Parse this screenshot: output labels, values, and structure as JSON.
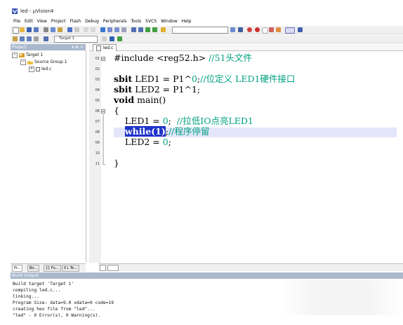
{
  "window": {
    "title": "led - μVision4"
  },
  "menu": [
    "File",
    "Edit",
    "View",
    "Project",
    "Flash",
    "Debug",
    "Peripherals",
    "Tools",
    "SVCS",
    "Window",
    "Help"
  ],
  "toolbar2": {
    "target_select": "Target 1"
  },
  "project_panel": {
    "title": "Project",
    "controls": "▾ ⊕ ×",
    "tree": [
      {
        "label": "Target 1",
        "toggle": "−"
      },
      {
        "label": "Source Group 1",
        "toggle": "−"
      },
      {
        "label": "led.c",
        "toggle": "+"
      }
    ],
    "bottom_tabs": [
      "Pr...",
      "Bo...",
      "{} Fu...",
      "0↓ Te..."
    ]
  },
  "editor": {
    "tab_label": "led.c",
    "line_numbers": [
      "01",
      "02",
      "03",
      "04",
      "05",
      "06",
      "07",
      "08",
      "09",
      "10",
      "11"
    ],
    "lines": {
      "l1_pre": "#include <reg52.h> ",
      "l1_comment": "//51头文件",
      "l3_kw": "sbit",
      "l3_rest": " LED1 = P1^",
      "l3_num": "0",
      "l3_semi": ";",
      "l3_comment": "//位定义 LED1硬件接口",
      "l4_kw": "sbit",
      "l4_rest": " LED2 = P1^1;",
      "l5_kw": "void",
      "l5_rest": " main()",
      "l6": "{",
      "l7_pre": "    LED1 = ",
      "l7_num": "0",
      "l7_semi": ";  ",
      "l7_comment": "//拉低IO点亮LED1",
      "l8_indent": "    ",
      "l8_sel": "while(1)",
      "l8_semi": ";",
      "l8_comment": "//程序停留",
      "l9_pre": "    LED2 = ",
      "l9_num": "0",
      "l9_semi": ";",
      "l11": "}"
    }
  },
  "build_output": {
    "title": "Build Output",
    "lines": [
      "Build target 'Target 1'",
      "compiling led.c...",
      "linking...",
      "Program Size: data=9.0 xdata=0 code=19",
      "creating hex file from \"led\"...",
      "\"led\" - 0 Error(s), 0 Warning(s)."
    ]
  }
}
